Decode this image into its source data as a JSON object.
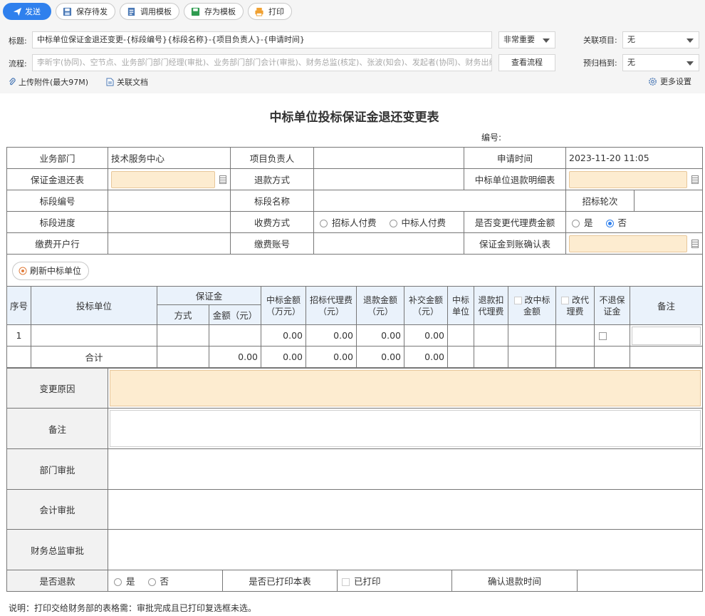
{
  "toolbar": {
    "send": "发送",
    "save_draft": "保存待发",
    "use_template": "调用模板",
    "save_template": "存为模板",
    "print": "打印"
  },
  "header": {
    "title_label": "标题:",
    "title_value": "中标单位保证金退还变更-{标段编号}{标段名称}-{项目负责人}-{申请时间}",
    "priority": "非常重要",
    "related_project_label": "关联项目:",
    "related_project_value": "无",
    "flow_label": "流程:",
    "flow_value": "李昕宇(协同)、空节点、业务部门部门经理(审批)、业务部门部门会计(审批)、财务总监(核定)、张波(知会)、发起者(协同)、财务出纳(协",
    "view_flow": "查看流程",
    "archive_label": "预归档到:",
    "archive_value": "无",
    "upload": "上传附件(最大97M)",
    "related_doc": "关联文档",
    "more_settings": "更多设置"
  },
  "form": {
    "title": "中标单位投标保证金退还变更表",
    "number_label": "编号:",
    "dept_label": "业务部门",
    "dept_value": "技术服务中心",
    "pm_label": "项目负责人",
    "apply_time_label": "申请时间",
    "apply_time_value": "2023-11-20 11:05",
    "deposit_return_label": "保证金退还表",
    "refund_method_label": "退款方式",
    "winner_detail_label": "中标单位退款明细表",
    "section_no_label": "标段编号",
    "section_name_label": "标段名称",
    "bid_round_label": "招标轮次",
    "progress_label": "标段进度",
    "fee_method_label": "收费方式",
    "fee_opt1": "招标人付费",
    "fee_opt2": "中标人付费",
    "change_fee_label": "是否变更代理费金额",
    "yes": "是",
    "no": "否",
    "bank_label": "缴费开户行",
    "account_label": "缴费账号",
    "confirm_label": "保证金到账确认表",
    "refresh_btn": "刷新中标单位"
  },
  "grid": {
    "h_seq": "序号",
    "h_bidder": "投标单位",
    "h_deposit": "保证金",
    "h_mode": "方式",
    "h_amount": "金额（元）",
    "h_win_amount": "中标金额（万元）",
    "h_agent_fee": "招标代理费（元）",
    "h_refund": "退款金额（元）",
    "h_extra": "补交金额（元）",
    "h_winner": "中标单位",
    "h_refund_fee": "退款扣代理费",
    "h_change_win": "改中标金额",
    "h_change_fee": "改代理费",
    "h_no_return": "不退保证金",
    "h_remark": "备注",
    "row1": {
      "seq": "1",
      "win_amount": "0.00",
      "agent_fee": "0.00",
      "refund": "0.00",
      "extra": "0.00"
    },
    "total": {
      "label": "合计",
      "amount": "0.00",
      "win_amount": "0.00",
      "agent_fee": "0.00",
      "refund": "0.00",
      "extra": "0.00"
    }
  },
  "approval": {
    "change_reason": "变更原因",
    "remark": "备注",
    "dept": "部门审批",
    "accounting": "会计审批",
    "cfo": "财务总监审批",
    "refunded_label": "是否退款",
    "printed_label": "是否已打印本表",
    "printed_opt": "已打印",
    "confirm_time_label": "确认退款时间"
  },
  "note": "说明：打印交给财务部的表格需：审批完成且已打印复选框未选。"
}
